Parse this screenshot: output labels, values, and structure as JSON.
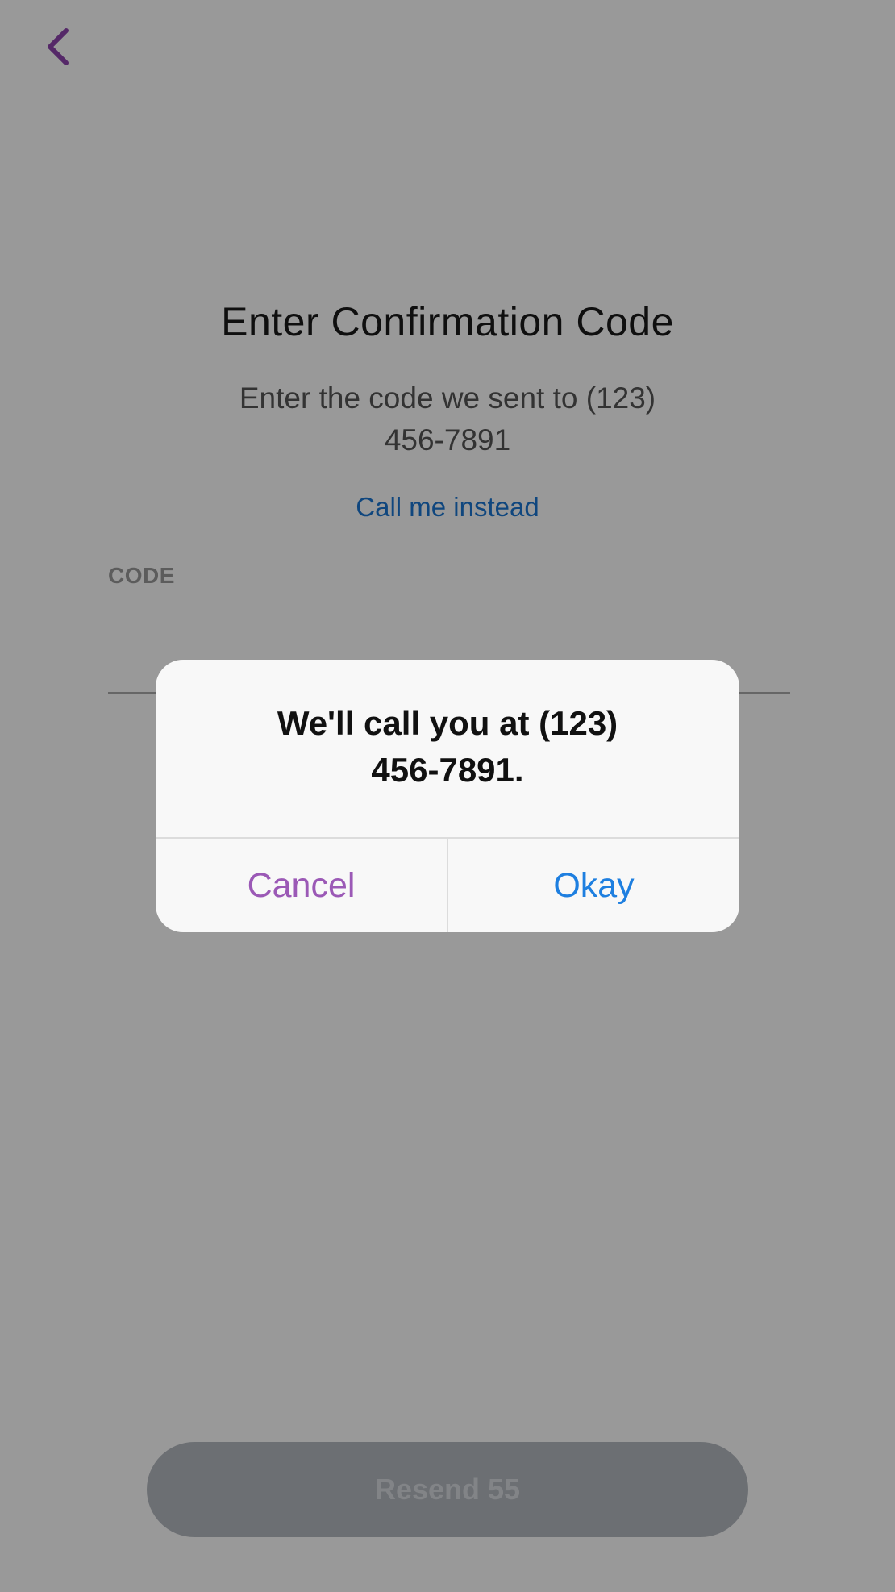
{
  "header": {
    "back_icon": "chevron-left-icon",
    "title": "Enter Confirmation Code",
    "subtitle": "Enter the code we sent to (123) 456-7891",
    "call_link": "Call me instead"
  },
  "form": {
    "code_label": "CODE",
    "code_value": ""
  },
  "footer": {
    "resend_label": "Resend 55"
  },
  "dialog": {
    "message": "We'll call you at (123) 456-7891.",
    "cancel_label": "Cancel",
    "okay_label": "Okay"
  },
  "colors": {
    "accent_purple": "#9b59b6",
    "link_blue": "#1976d2",
    "okay_blue": "#1e7fe0",
    "back_icon": "#8e44ad"
  }
}
